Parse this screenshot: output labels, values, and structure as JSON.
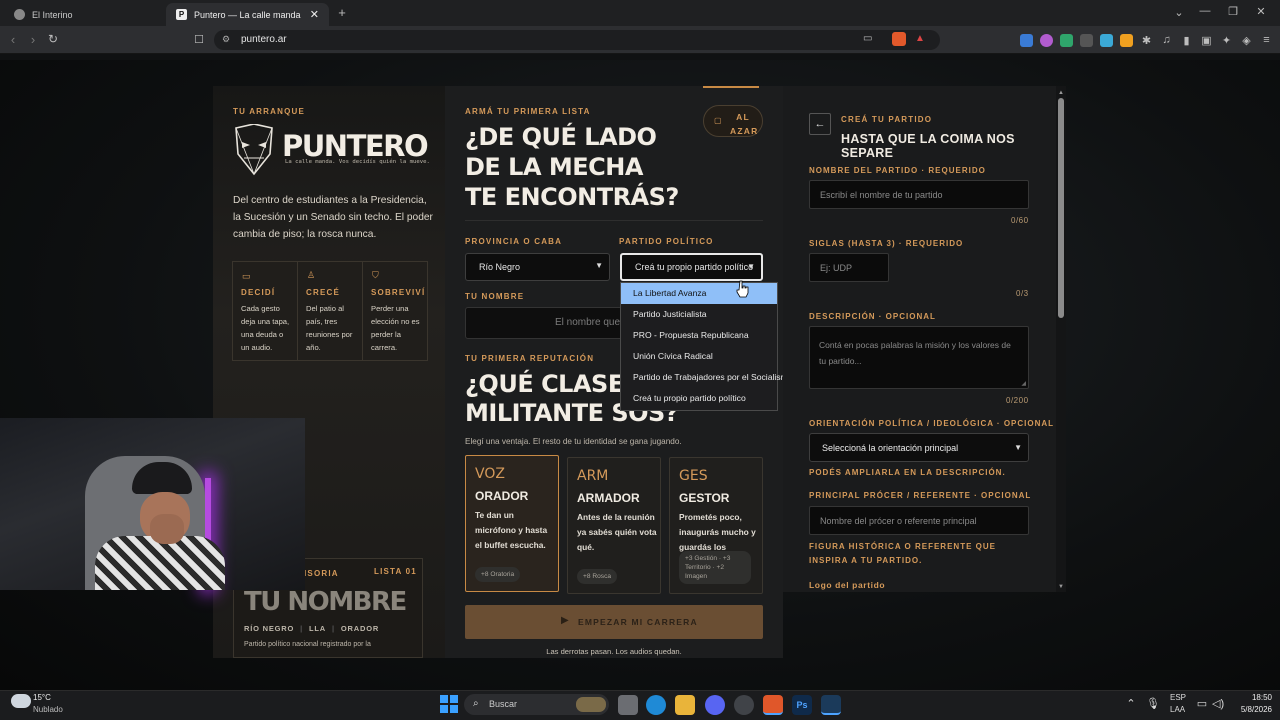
{
  "browser": {
    "tabs": [
      {
        "label": "El Interino"
      },
      {
        "label": "Puntero — La calle manda"
      }
    ],
    "new_tab": "+",
    "url": "puntero.ar"
  },
  "left": {
    "kicker": "TU ARRANQUE",
    "logo": "PUNTERO",
    "tagline": "La calle manda. Vos decidís quién la mueve.",
    "intro": "Del centro de estudiantes a la Presidencia, la Sucesión y un Senado sin techo. El poder cambia de piso; la rosca nunca.",
    "features": [
      {
        "title": "DECIDÍ",
        "text": "Cada gesto deja una tapa, una deuda o un audio.",
        "icon": "ballot-icon"
      },
      {
        "title": "CRECÉ",
        "text": "Del patio al país, tres reuniones por año.",
        "icon": "person-icon"
      },
      {
        "title": "SOBREVIVÍ",
        "text": "Perder una elección no es perder la carrera.",
        "icon": "shield-icon"
      }
    ],
    "preview": {
      "kicker_left": "ISORIA",
      "kicker_right": "LISTA 01",
      "name": "TU NOMBRE",
      "meta": [
        "RÍO NEGRO",
        "LLA",
        "ORADOR"
      ],
      "note": "Partido político nacional registrado por la"
    }
  },
  "middle": {
    "kicker": "ARMÁ TU PRIMERA LISTA",
    "title": [
      "¿DE QUÉ LADO",
      "DE LA MECHA",
      "TE ENCONTRÁS?"
    ],
    "random_button": "AL AZAR",
    "province_label": "PROVINCIA O CABA",
    "province_value": "Río Negro",
    "party_label": "PARTIDO POLÍTICO",
    "party_value": "Creá tu propio partido político",
    "party_options": [
      "La Libertad Avanza",
      "Partido Justicialista",
      "PRO - Propuesta Republicana",
      "Unión Cívica Radical",
      "Partido de Trabajadores por el Socialismo",
      "Creá tu propio partido político"
    ],
    "name_label": "TU NOMBRE",
    "name_placeholder": "El nombre que v",
    "rep_kicker": "TU PRIMERA REPUTACIÓN",
    "rep_title": [
      "¿QUÉ CLASE DE",
      "MILITANTE SOS?"
    ],
    "rep_sub": "Elegí una ventaja. El resto de tu identidad se gana jugando.",
    "classes": [
      {
        "code": "VOZ",
        "name": "ORADOR",
        "desc": "Te dan un micrófono y hasta el buffet escucha.",
        "bonus": "+8 Oratoria"
      },
      {
        "code": "ARM",
        "name": "ARMADOR",
        "desc": "Antes de la reunión ya sabés quién vota qué.",
        "bonus": "+8 Rosca"
      },
      {
        "code": "GES",
        "name": "GESTOR",
        "desc": "Prometés poco, inaugurás mucho y guardás los recibos.",
        "bonus": "+3 Gestión · +3 Territorio · +2 Imagen"
      }
    ],
    "start_button": "EMPEZAR MI CARRERA",
    "footer": "Las derrotas pasan. Los audios quedan."
  },
  "right": {
    "kicker": "CREÁ TU PARTIDO",
    "title": "HASTA QUE LA COIMA NOS SEPARE",
    "name_label": "NOMBRE DEL PARTIDO · REQUERIDO",
    "name_placeholder": "Escribí el nombre de tu partido",
    "name_counter": "0/60",
    "siglas_label": "SIGLAS (HASTA 3) · REQUERIDO",
    "siglas_placeholder": "Ej: UDP",
    "siglas_counter": "0/3",
    "desc_label": "DESCRIPCIÓN · OPCIONAL",
    "desc_placeholder": "Contá en pocas palabras la misión y los valores de tu partido...",
    "desc_counter": "0/200",
    "orient_label": "ORIENTACIÓN POLÍTICA / IDEOLÓGICA · OPCIONAL",
    "orient_value": "Seleccioná la orientación principal",
    "orient_hint": "PODÉS AMPLIARLA EN LA DESCRIPCIÓN.",
    "hero_label": "PRINCIPAL PRÓCER / REFERENTE · OPCIONAL",
    "hero_placeholder": "Nombre del prócer o referente principal",
    "hero_hint": "FIGURA HISTÓRICA O REFERENTE QUE INSPIRA A TU PARTIDO.",
    "logo_label": "Logo del partido"
  },
  "taskbar": {
    "weather_temp": "15°C",
    "weather_desc": "Nublado",
    "search": "Buscar",
    "lang": "ESP",
    "lang2": "LAA",
    "time": "18:50",
    "date": "5/8/2026"
  },
  "colors": {
    "accent": "#d59a5a",
    "button": "#6a4e33",
    "highlight": "#8fbff8"
  }
}
